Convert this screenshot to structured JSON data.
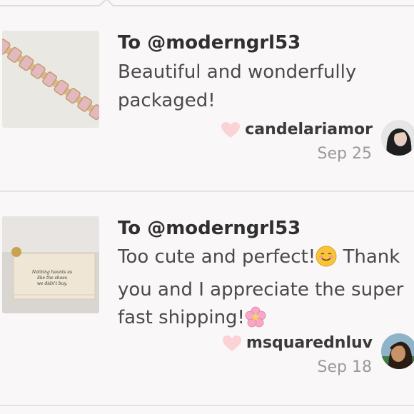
{
  "reviews": [
    {
      "to": "To @moderngrl53",
      "message": "Beautiful and wonderfully packaged!",
      "username": "candelariamor",
      "date": "Sep 25",
      "thumb_icon": "bracelet-photo",
      "avatar_icon": "user-avatar-photo"
    },
    {
      "to": "To @moderngrl53",
      "message_part1": "Too cute and perfect!",
      "message_part2": " Thank you and I appreciate the super fast shipping!",
      "username": "msquarednluv",
      "date": "Sep 18",
      "thumb_icon": "pouch-photo",
      "thumb_text": [
        "Nothing haunts us",
        "like the shoes",
        "we didn't buy."
      ],
      "avatar_icon": "user-avatar-photo"
    }
  ],
  "colors": {
    "heart": "#fbd3d7",
    "text": "#4a4a4a",
    "muted": "#9a9a9a"
  }
}
